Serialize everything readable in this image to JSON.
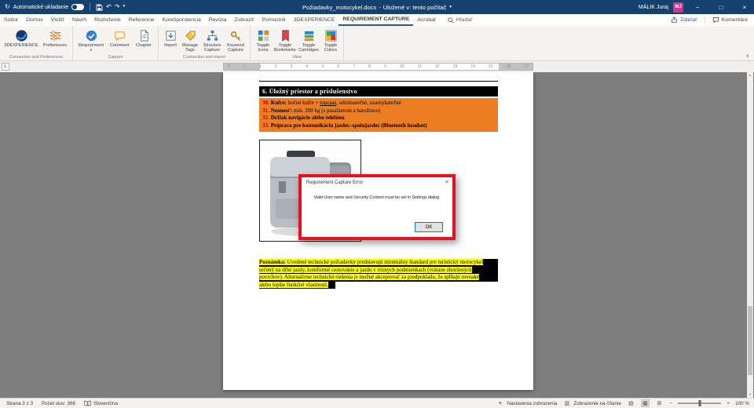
{
  "icons": {
    "autosave": "↻",
    "undo": "↶",
    "redo": "↷",
    "caret": "▾",
    "minimize": "−",
    "maximize": "□",
    "close": "×",
    "ribbon_collapse": "∧",
    "scroll_up": "▴",
    "scroll_down": "▾",
    "tab_selector": "L",
    "display_settings": "≡",
    "reading_view": "▥",
    "view_read": "▤",
    "view_print": "▦",
    "view_web": "⊞",
    "zoom_out": "−",
    "zoom_in": "+"
  },
  "colors": {
    "titlebar_bg": "#15416E",
    "accent_blue": "#2B579A",
    "heading_bg": "#000000",
    "requirements_bg": "#ED7D23",
    "number_red": "#C00000",
    "dialog_border_red": "#E81123",
    "highlight_yellow": "#FFFF00",
    "avatar_pink": "#D6358B"
  },
  "titlebar": {
    "autosave_label": "Automatické ukladanie",
    "doc_title": "Požiadavky_motocykel.docx",
    "title_separator": "-",
    "save_location": "Uložené v: tento počítač",
    "user_name": "MÁLIK Juraj",
    "user_initials": "MJ"
  },
  "menubar": {
    "tabs": [
      "Súbor",
      "Domov",
      "Vložiť",
      "Návrh",
      "Rozloženie",
      "Referencie",
      "Korešpondencia",
      "Revízia",
      "Zobraziť",
      "Pomocník",
      "3DEXPERIENCE",
      "REQUIREMENT CAPTURE",
      "Acrobat"
    ],
    "active_tab": "REQUIREMENT CAPTURE",
    "search_label": "Hľadať",
    "share_label": "Zdieľať",
    "comments_label": "Komentáre"
  },
  "ribbon": {
    "groups": [
      {
        "label": "Connection and Preferences",
        "buttons": [
          "3DEXPERIENCE",
          "Preferences"
        ]
      },
      {
        "label": "Capture",
        "buttons": [
          "Requirement",
          "Comment",
          "Chapter"
        ]
      },
      {
        "label": "Connection and import",
        "buttons": [
          "Import",
          "Manage Tags",
          "Structure Capture",
          "Keyword Capture"
        ]
      },
      {
        "label": "View",
        "buttons": [
          "Toggle Icons",
          "Toggle Bookmarks",
          "Toggle Cartridges",
          "Toggle Colors"
        ]
      }
    ]
  },
  "ruler": {
    "numbers": [
      "2",
      "1",
      "1",
      "2",
      "3",
      "4",
      "5",
      "6",
      "7",
      "8",
      "9",
      "10",
      "11",
      "12",
      "13",
      "14",
      "15",
      "16",
      "17"
    ]
  },
  "document": {
    "heading": "6. Úložný priestor a príslušenstvo",
    "requirements": [
      {
        "num": "30.",
        "bold": "Kufre:",
        "plain1": " bočné kufre + ",
        "underline": "topcase",
        "plain2": ", odnímateľné, uzamykateľné"
      },
      {
        "num": "31.",
        "bold": "Nosnosť:",
        "plain1": " min. 200 kg (s pasažierom a batožinou)",
        "underline": "",
        "plain2": ""
      },
      {
        "num": "32.",
        "bold": "Držiak navigácie alebo telefónu",
        "plain1": "",
        "underline": "",
        "plain2": ""
      },
      {
        "num": "33.",
        "bold": "Príprava pre komunikáciu jazdec–spolujazdec (Bluetooth headset)",
        "plain1": "",
        "underline": "",
        "plain2": ""
      }
    ],
    "note": {
      "bold": "Poznámka:",
      "line1": " Uvedené technické požiadavky predstavujú minimálny štandard pre turistický motocykel",
      "line2": "určený na dlhé jazdy, komfortné cestovanie a jazdu v rôznych podmienkach (vrátane zhoršených",
      "line3": "povrchov). Alternatívne technické riešenia je možné akceptovať za predpokladu, že spĺňajú rovnaké",
      "line4": "alebo lepšie funkčné vlastnosti."
    }
  },
  "dialog": {
    "title": "Requirement Capture Error",
    "message": "Valid User name and Security Context must be set in Settings dialog.",
    "ok_label": "OK"
  },
  "statusbar": {
    "page_info": "Strana 3 z 3",
    "word_count": "Počet slov: 366",
    "language": "Slovenčina",
    "display_settings": "Nastavenia zobrazenia",
    "reading_view": "Zobrazenie na čítanie",
    "zoom": "100 %"
  }
}
